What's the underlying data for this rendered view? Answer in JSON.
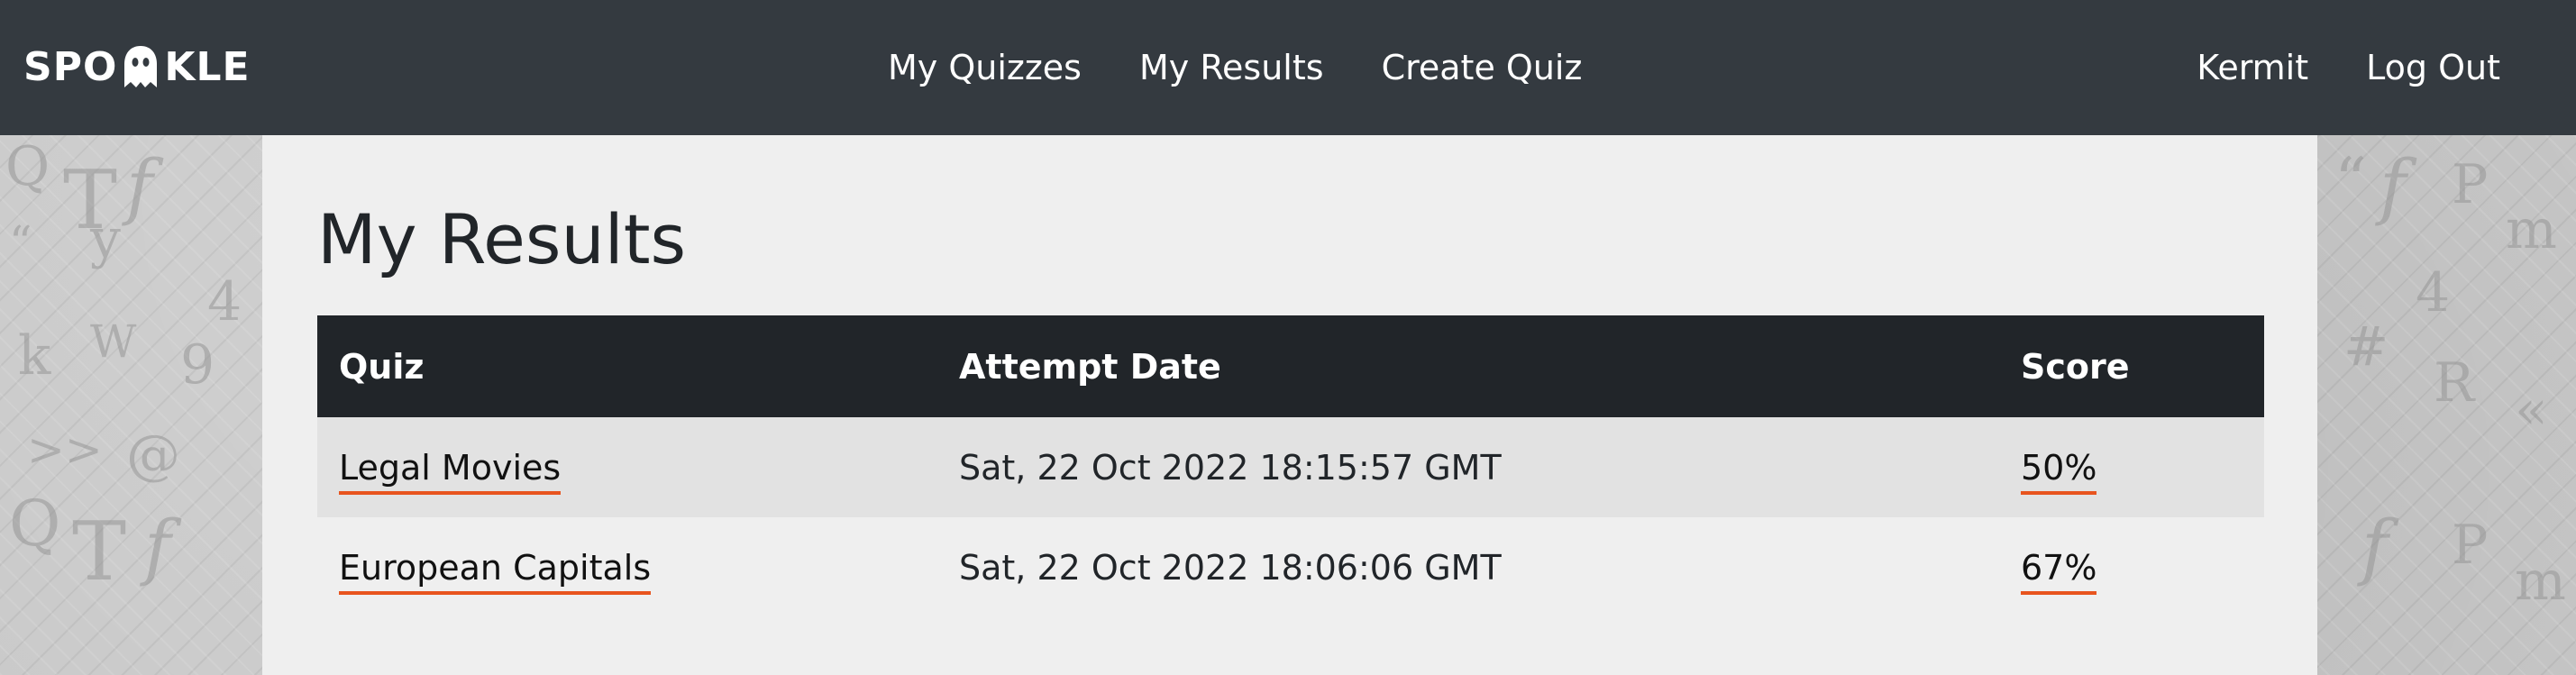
{
  "app": {
    "logo_text_left": "SPO",
    "logo_text_right": "KLE",
    "logo_icon": "ghost-icon"
  },
  "nav": {
    "my_quizzes": "My Quizzes",
    "my_results": "My Results",
    "create_quiz": "Create Quiz",
    "user": "Kermit",
    "log_out": "Log Out"
  },
  "page": {
    "title": "My Results"
  },
  "table": {
    "headers": [
      "Quiz",
      "Attempt Date",
      "Score"
    ],
    "rows": [
      {
        "quiz": "Legal Movies",
        "date": "Sat, 22 Oct 2022 18:15:57 GMT",
        "score": "50%"
      },
      {
        "quiz": "European Capitals",
        "date": "Sat, 22 Oct 2022 18:06:06 GMT",
        "score": "67%"
      }
    ]
  },
  "colors": {
    "navbar": "#343a40",
    "table_header": "#212529",
    "link_underline": "#e8541e",
    "card": "#efefef"
  }
}
